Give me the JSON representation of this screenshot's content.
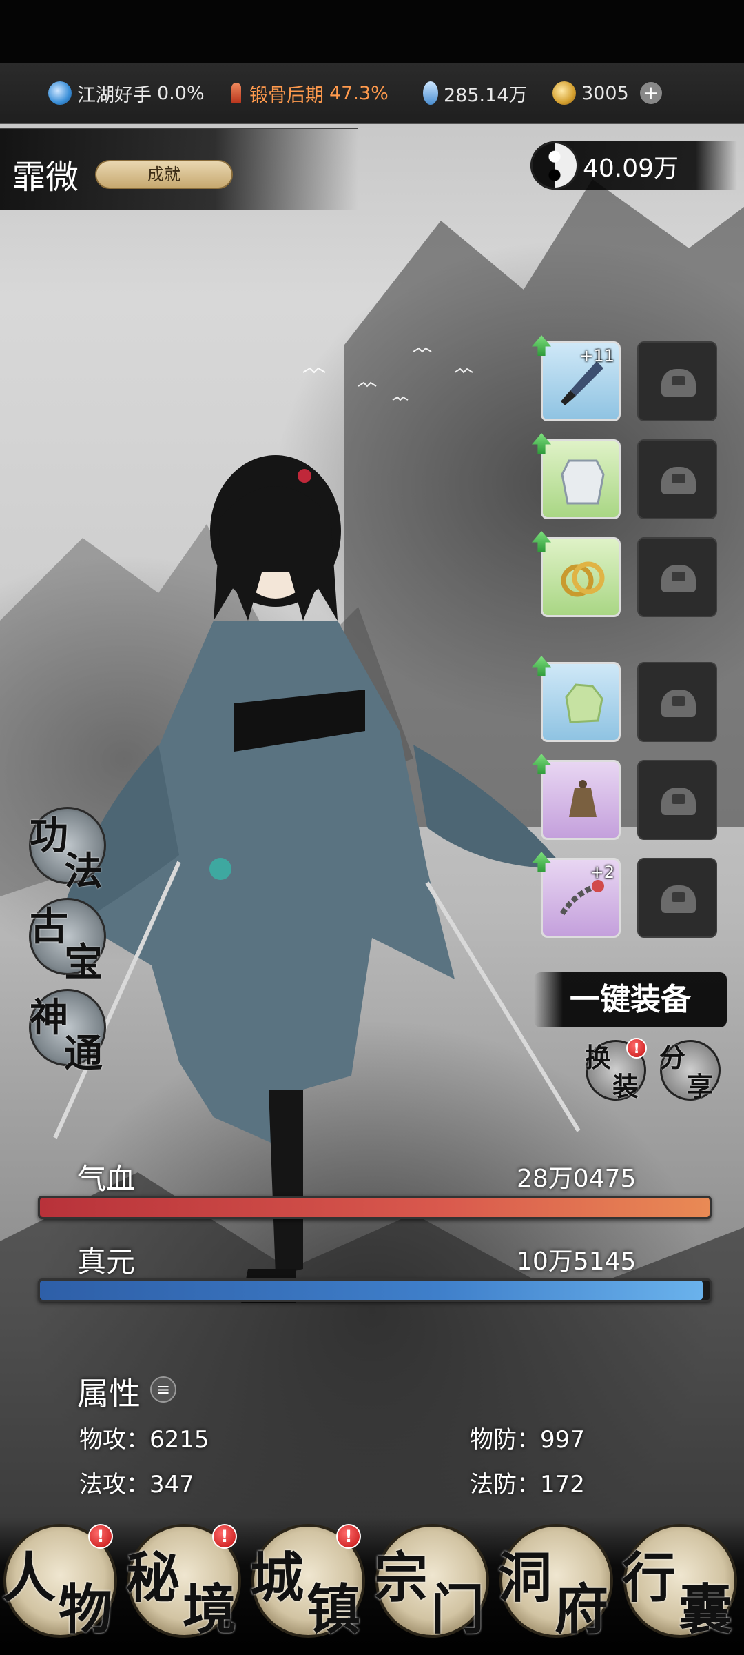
{
  "resources": {
    "realm_label": "江湖好手",
    "realm_percent": "0.0%",
    "cultivation_label": "锻骨后期",
    "cultivation_percent": "47.3%",
    "spirit_water": "285.14万",
    "gold_coins": "3005",
    "add_symbol": "+"
  },
  "player": {
    "name": "霏微",
    "achievement_button": "成就",
    "combat_power": "40.09万"
  },
  "equipment": [
    {
      "slot": "weapon",
      "level": "+11",
      "rarity": "blue",
      "icon": "dagger-icon"
    },
    {
      "slot": "armor",
      "level": "",
      "rarity": "green",
      "icon": "armor-icon"
    },
    {
      "slot": "ring",
      "level": "",
      "rarity": "green",
      "icon": "ring-icon"
    },
    {
      "slot": "jade",
      "level": "",
      "rarity": "blue",
      "icon": "jade-stone-icon"
    },
    {
      "slot": "bell",
      "level": "",
      "rarity": "purple",
      "icon": "bell-icon"
    },
    {
      "slot": "bracelet",
      "level": "+2",
      "rarity": "purple",
      "icon": "chain-bracelet-icon"
    }
  ],
  "side_menu": {
    "skills": [
      "功",
      "法"
    ],
    "treasures": [
      "古",
      "宝"
    ],
    "powers": [
      "神",
      "通"
    ]
  },
  "actions": {
    "one_key_equip": "一键装备",
    "change_outfit": [
      "换",
      "装"
    ],
    "share": [
      "分",
      "享"
    ],
    "badge_symbol": "!"
  },
  "stats": {
    "hp_label": "气血",
    "hp_value": "28万0475",
    "hp_fill": 1.0,
    "mp_label": "真元",
    "mp_value": "10万5145",
    "mp_fill": 0.99,
    "attributes_title": "属性",
    "phys_atk": "物攻：6215",
    "phys_def": "物防：997",
    "mag_atk": "法攻：347",
    "mag_def": "法防：172"
  },
  "nav": [
    {
      "chars": [
        "人",
        "物"
      ],
      "badge": true
    },
    {
      "chars": [
        "秘",
        "境"
      ],
      "badge": true
    },
    {
      "chars": [
        "城",
        "镇"
      ],
      "badge": true
    },
    {
      "chars": [
        "宗",
        "门"
      ],
      "badge": false
    },
    {
      "chars": [
        "洞",
        "府"
      ],
      "badge": false
    },
    {
      "chars": [
        "行",
        "囊"
      ],
      "badge": false
    }
  ],
  "colors": {
    "hp_bar": "#d9594d",
    "mp_bar": "#3f7fca",
    "accent_orange": "#ff9a4d",
    "badge_red": "#c21010"
  }
}
